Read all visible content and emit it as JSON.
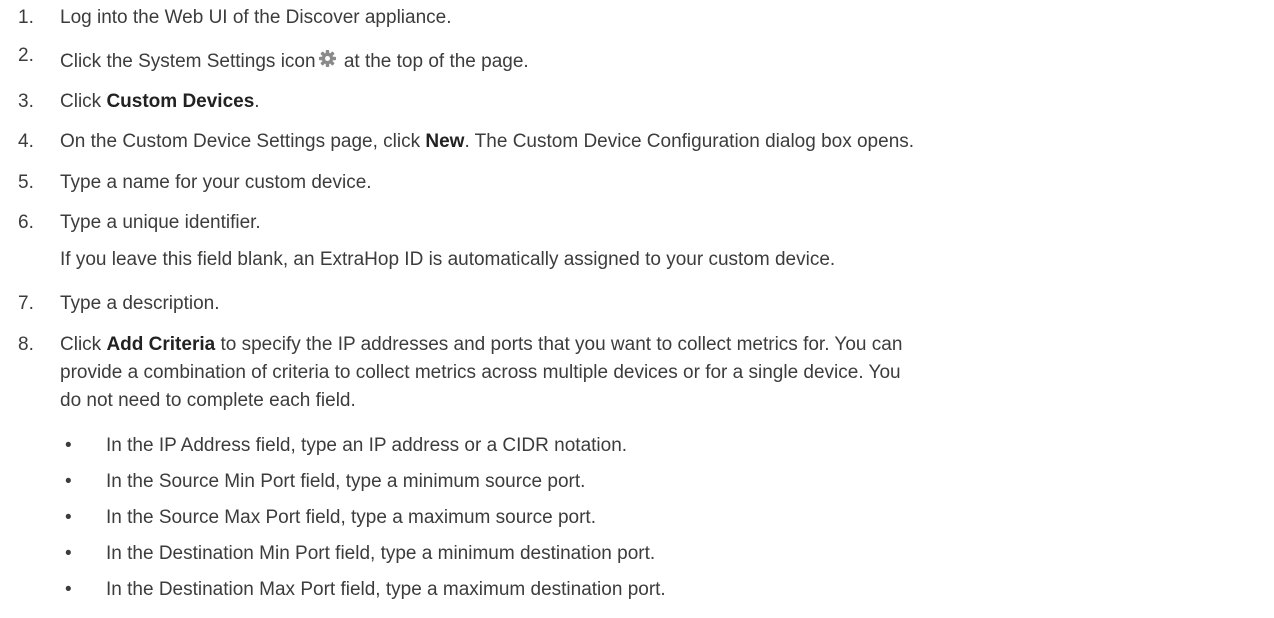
{
  "steps": [
    {
      "num": "1.",
      "text": "Log into the Web UI of the Discover appliance."
    },
    {
      "num": "2.",
      "before": "Click the System Settings icon",
      "after": " at the top of the page.",
      "icon": "gear-icon"
    },
    {
      "num": "3.",
      "before": "Click ",
      "bold": "Custom Devices",
      "after": "."
    },
    {
      "num": "4.",
      "before": "On the Custom Device Settings page, click ",
      "bold": "New",
      "after": ". The Custom Device Configuration dialog box opens."
    },
    {
      "num": "5.",
      "text": "Type a name for your custom device."
    },
    {
      "num": "6.",
      "text": "Type a unique identifier.",
      "note": "If you leave this field blank, an ExtraHop ID is automatically assigned to your custom device."
    },
    {
      "num": "7.",
      "text": "Type a description."
    },
    {
      "num": "8.",
      "before": "Click ",
      "bold": "Add Criteria",
      "after_lines": [
        " to specify the IP addresses and ports that you want to collect metrics for. You can",
        "provide a combination of criteria to collect metrics across multiple devices or for a single device. You",
        "do not need to complete each field."
      ]
    }
  ],
  "bullets": [
    "In the IP Address field, type an IP address or a CIDR notation.",
    "In the Source Min Port field, type a minimum source port.",
    "In the Source Max Port field, type a maximum source port.",
    "In the Destination Min Port field, type a minimum destination port.",
    "In the Destination Max Port field, type a maximum destination port."
  ],
  "bullet_char": "•",
  "colors": {
    "text": "#3c3c3c",
    "bold": "#222222",
    "icon": "#8a8a8a"
  }
}
